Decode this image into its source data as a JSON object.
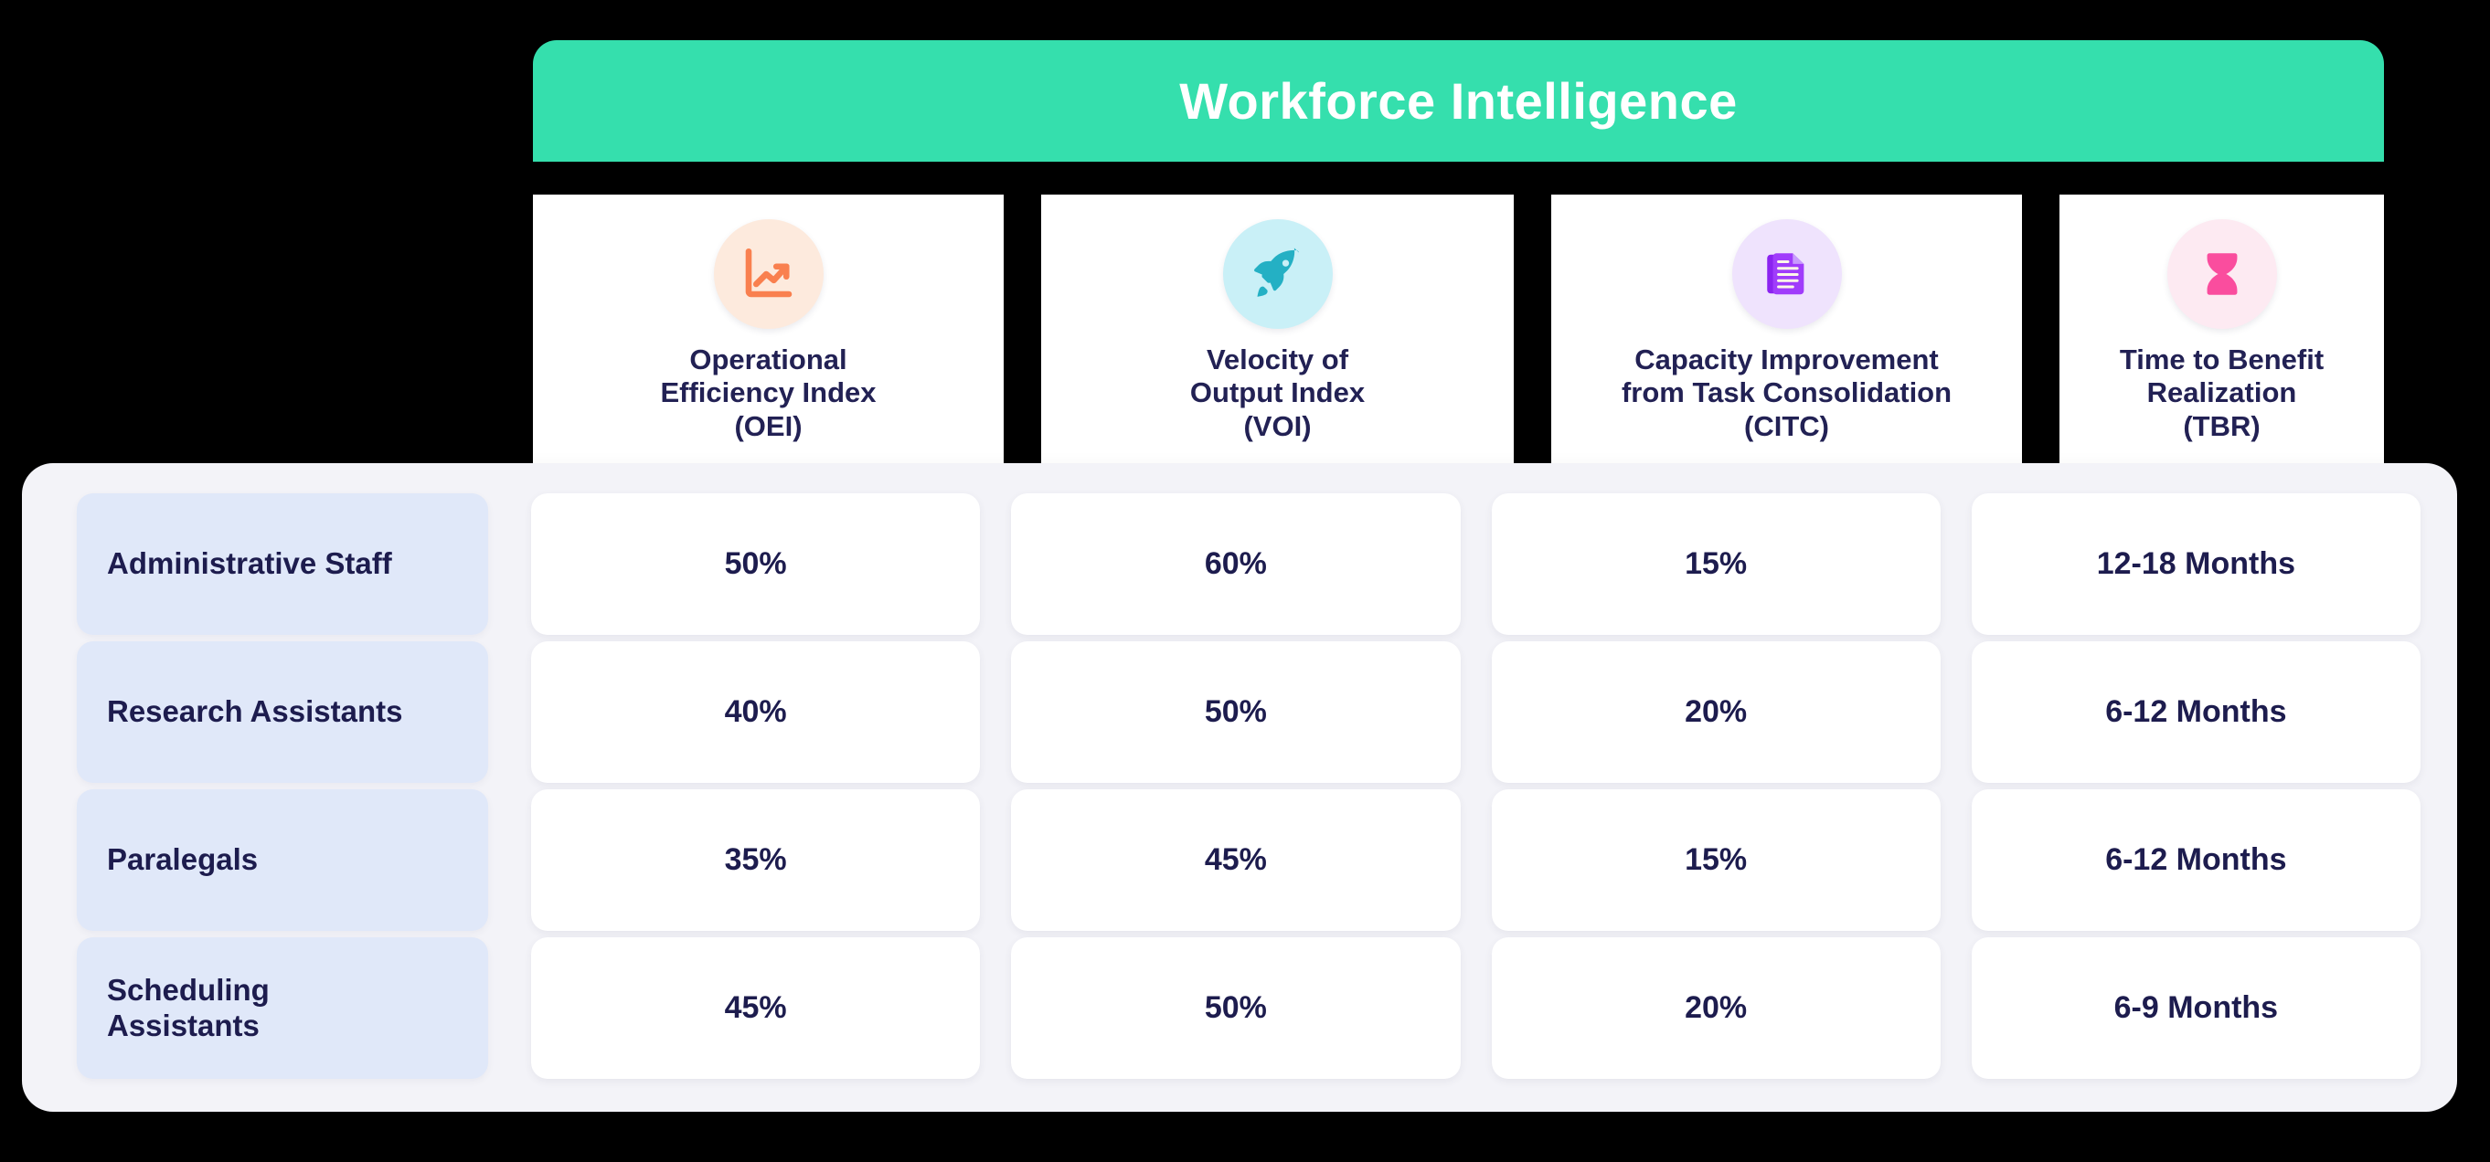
{
  "header": {
    "title": "Workforce Intelligence",
    "banner_color": "#35dfad",
    "metrics": [
      {
        "icon": "chart-line-up-icon",
        "icon_bg": "#fdeadd",
        "icon_color": "#f9804f",
        "label": "Operational\nEfficiency Index\n(OEI)"
      },
      {
        "icon": "rocket-icon",
        "icon_bg": "#c9f0f7",
        "icon_color": "#24b0c4",
        "label": "Velocity of\nOutput Index\n(VOI)"
      },
      {
        "icon": "documents-icon",
        "icon_bg": "#efe3fd",
        "icon_color": "#9333ea",
        "label": "Capacity Improvement\nfrom Task Consolidation\n(CITC)"
      },
      {
        "icon": "hourglass-icon",
        "icon_bg": "#fdeaf2",
        "icon_color": "#fa4d9e",
        "label": "Time to Benefit\nRealization\n(TBR)"
      }
    ]
  },
  "table": {
    "label_bg": "#e0e8f9",
    "cell_bg": "#ffffff",
    "text_color": "#1d1c4e",
    "panel_bg": "#f3f3f8",
    "columns": [
      "Operational Efficiency Index (OEI)",
      "Velocity of Output Index (VOI)",
      "Capacity Improvement from Task Consolidation (CITC)",
      "Time to Benefit Realization (TBR)"
    ],
    "rows": [
      {
        "label": "Administrative Staff",
        "values": [
          "50%",
          "60%",
          "15%",
          "12-18 Months"
        ]
      },
      {
        "label": "Research Assistants",
        "values": [
          "40%",
          "50%",
          "20%",
          "6-12 Months"
        ]
      },
      {
        "label": "Paralegals",
        "values": [
          "35%",
          "45%",
          "15%",
          "6-12 Months"
        ]
      },
      {
        "label": "Scheduling\nAssistants",
        "values": [
          "45%",
          "50%",
          "20%",
          "6-9 Months"
        ]
      }
    ]
  }
}
